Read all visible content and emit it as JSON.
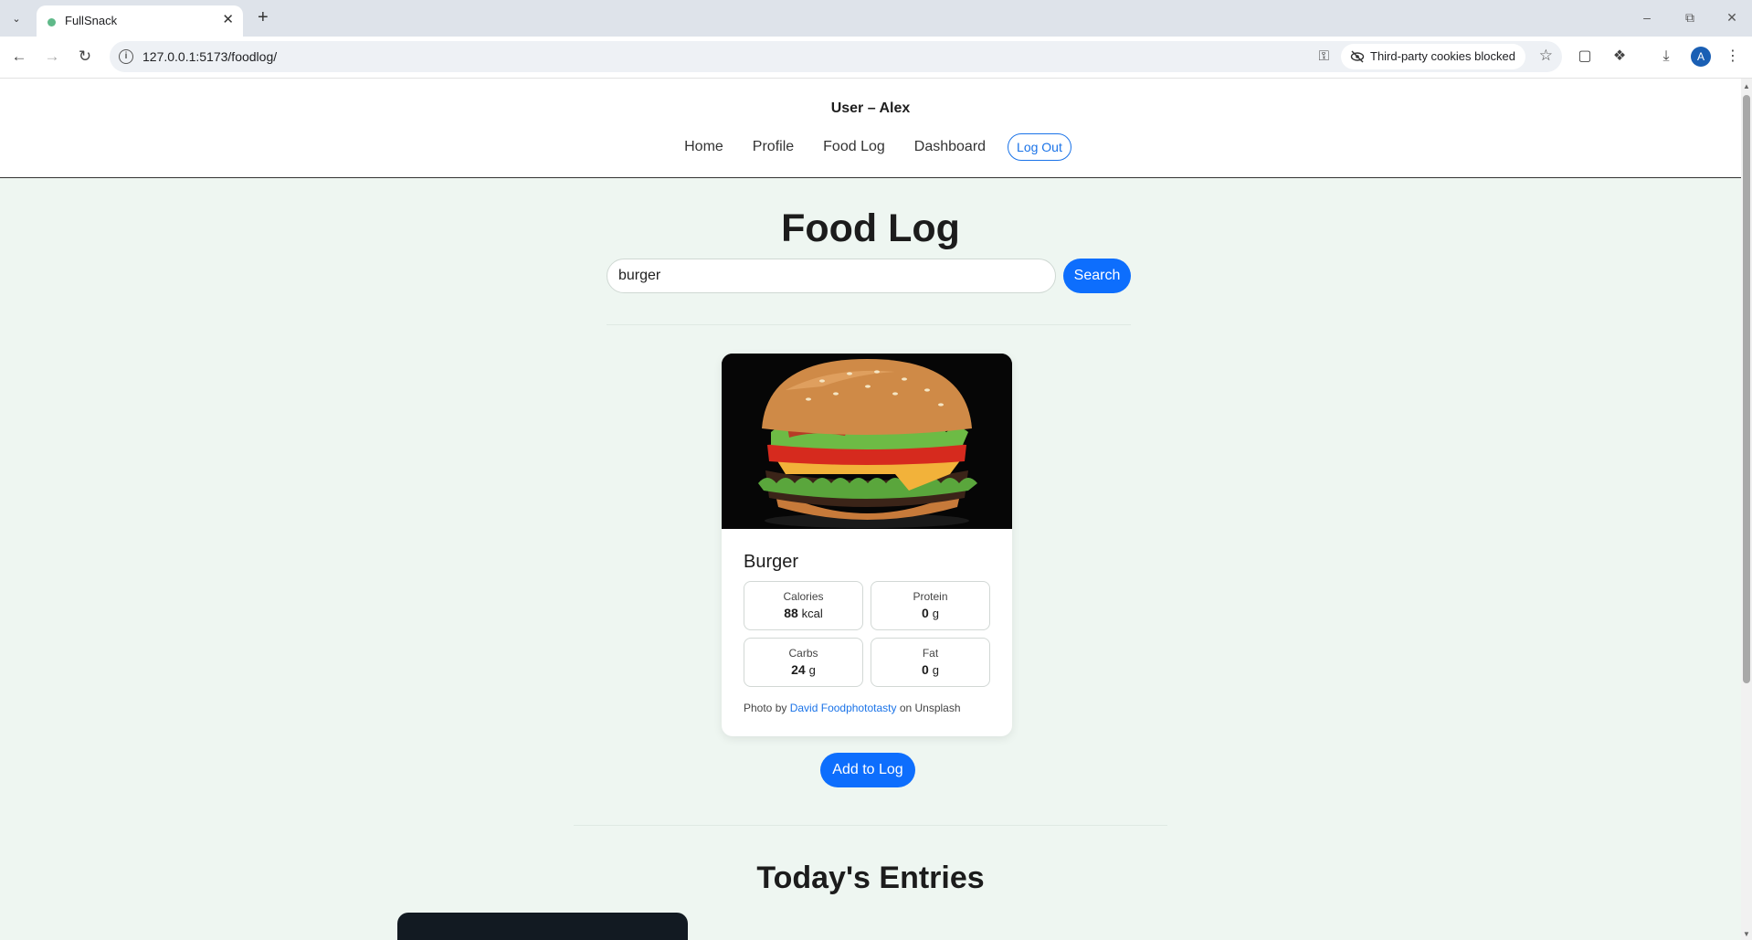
{
  "browser": {
    "tab_title": "FullSnack",
    "url": "127.0.0.1:5173/foodlog/",
    "cookie_notice": "Third-party cookies blocked",
    "profile_initial": "A"
  },
  "header": {
    "user_line": "User – Alex",
    "nav": {
      "home": "Home",
      "profile": "Profile",
      "food_log": "Food Log",
      "dashboard": "Dashboard",
      "logout": "Log Out"
    }
  },
  "main": {
    "title": "Food Log",
    "search": {
      "value": "burger",
      "button": "Search"
    },
    "result": {
      "name": "Burger",
      "nutrients": {
        "calories_label": "Calories",
        "calories_value": "88",
        "calories_unit": "kcal",
        "protein_label": "Protein",
        "protein_value": "0",
        "protein_unit": "g",
        "carbs_label": "Carbs",
        "carbs_value": "24",
        "carbs_unit": "g",
        "fat_label": "Fat",
        "fat_value": "0",
        "fat_unit": "g"
      },
      "credit_prefix": "Photo by",
      "credit_author": "David Foodphototasty",
      "credit_suffix": "on Unsplash"
    },
    "add_button": "Add to Log",
    "entries_title": "Today's Entries"
  },
  "colors": {
    "accent": "#0d6efd",
    "page_bg": "#eef6f1",
    "entry_card_bg": "#121a22"
  }
}
